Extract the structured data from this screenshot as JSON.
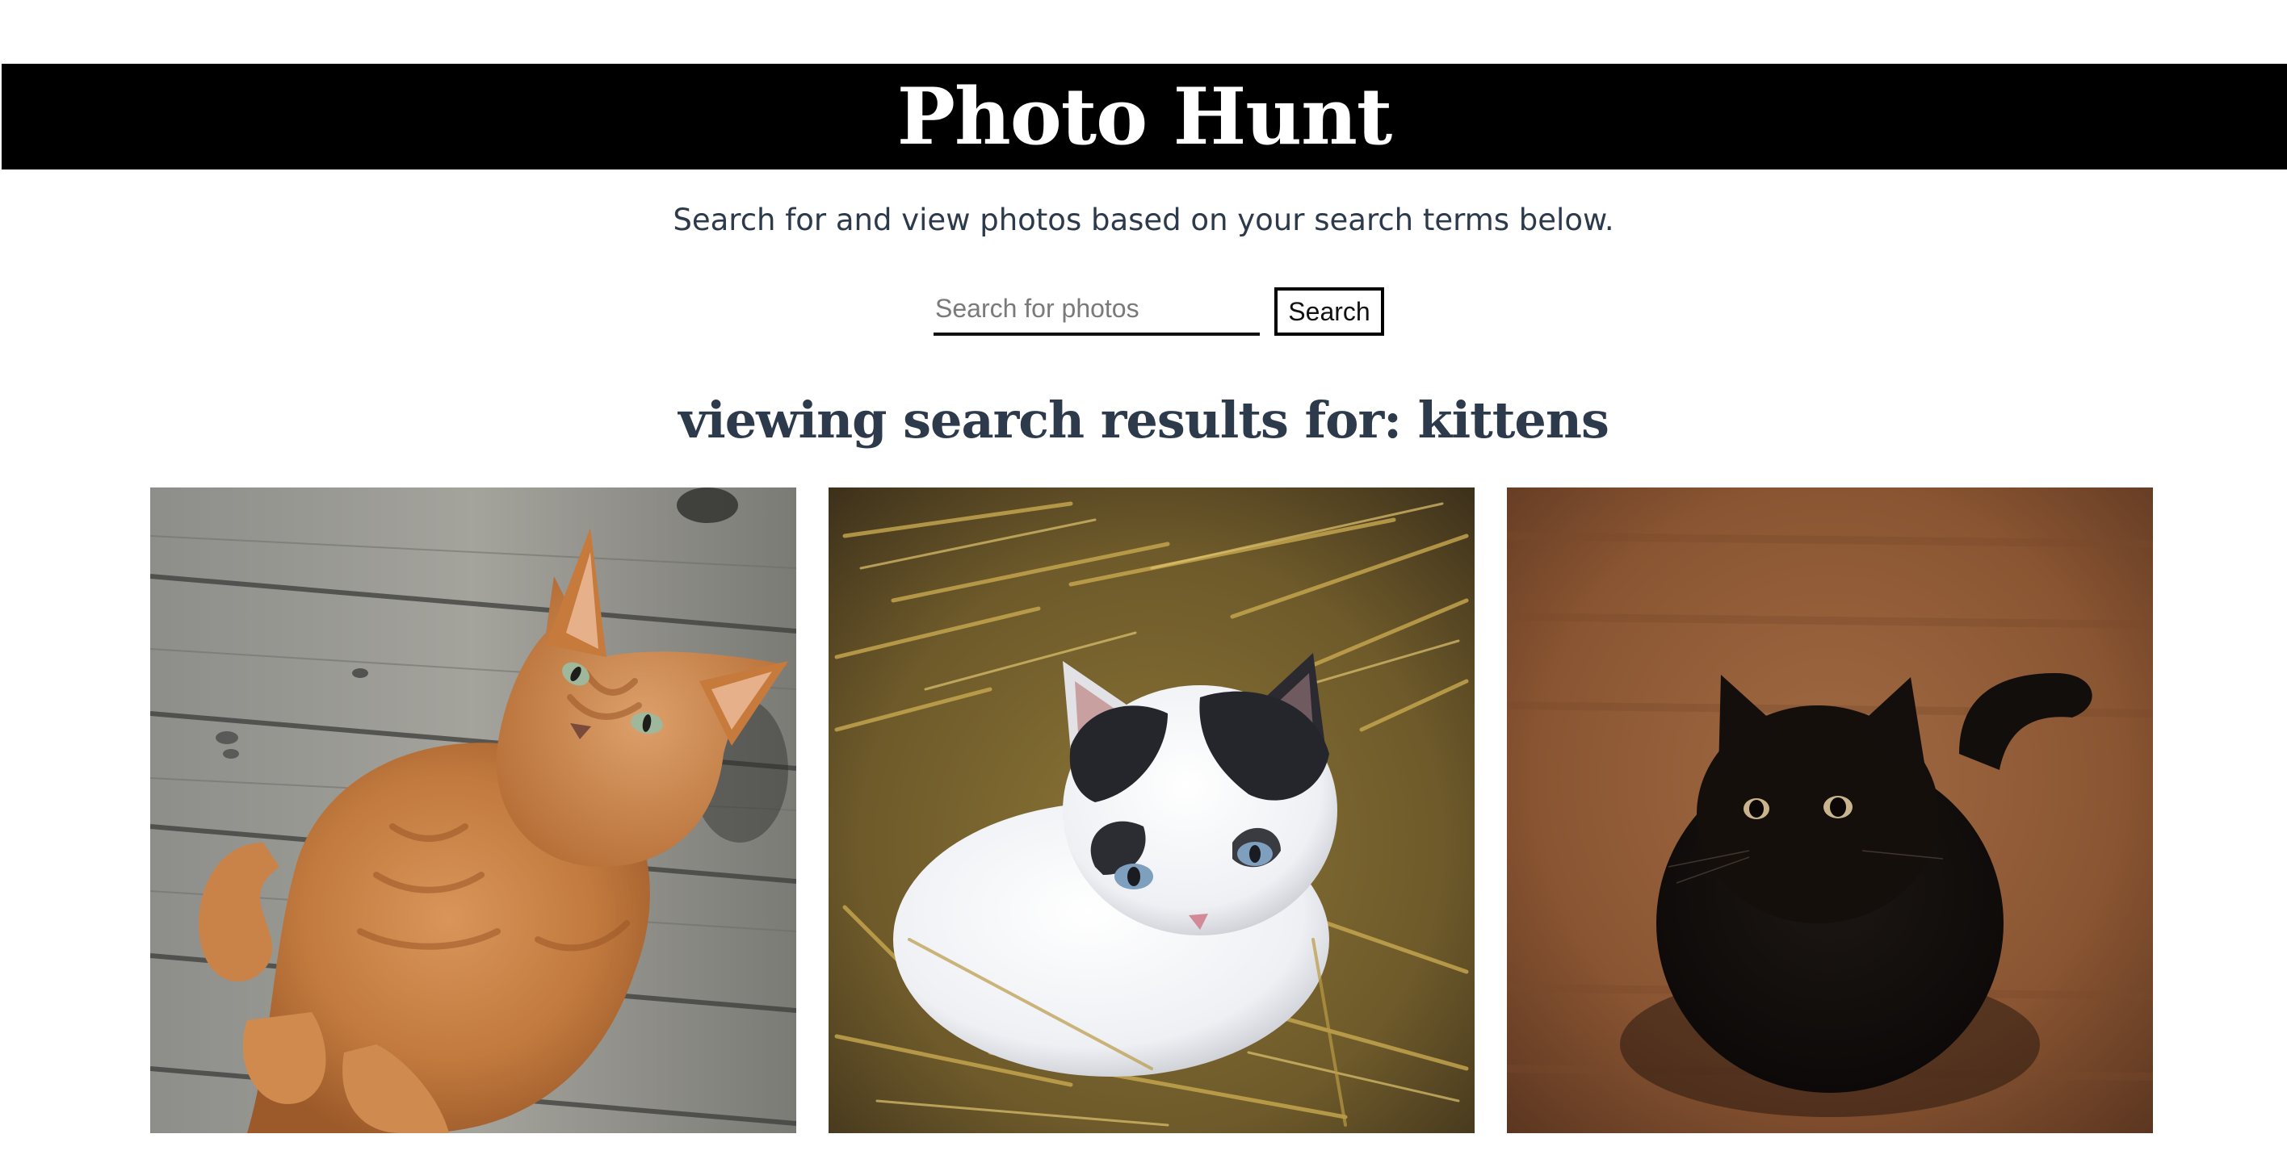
{
  "header": {
    "title": "Photo Hunt"
  },
  "intro": {
    "text": "Search for and view photos based on your search terms below."
  },
  "search": {
    "placeholder": "Search for photos",
    "value": "",
    "button_label": "Search"
  },
  "results": {
    "heading": "viewing search results for: kittens",
    "photos": [
      {
        "subject": "orange tabby cat lying on wooden planks"
      },
      {
        "subject": "white and black kitten in straw"
      },
      {
        "subject": "black cat on brown background"
      }
    ]
  },
  "colors": {
    "header_background": "#000000",
    "header_text": "#ffffff",
    "body_text": "#2c3a4b"
  }
}
